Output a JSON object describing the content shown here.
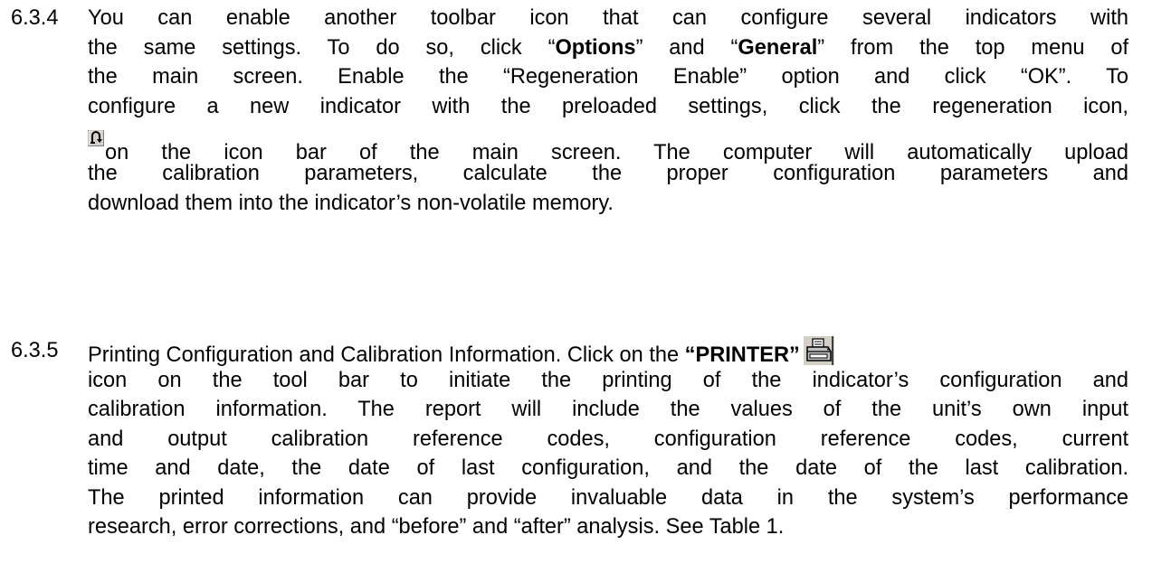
{
  "sec634": {
    "number": "6.3.4",
    "l1": "You can enable another toolbar icon that can configure several indicators with",
    "l2a": "the same settings.  To do so, click “",
    "l2b": "Options",
    "l2c": "” and “",
    "l2d": "General",
    "l2e": "” from the top menu of",
    "l3": "the main screen.  Enable the “Regeneration Enable” option and click “OK”.  To",
    "l4": "configure a new indicator with the preloaded settings, click the regeneration icon,",
    "l5": "on the icon bar of the main screen.  The computer will automatically upload",
    "l6": "the calibration parameters, calculate the proper configuration parameters and",
    "l7": "download them into the indicator’s non-volatile memory."
  },
  "sec635": {
    "number": "6.3.5",
    "l1a": "Printing Configuration and Calibration Information.  Click on the ",
    "l1b": "“PRINTER”",
    "l2": "icon on the tool bar to initiate the printing of the indicator’s configuration and",
    "l3": "calibration information.  The report will include the values of the unit’s own input",
    "l4": "and output calibration reference codes, configuration reference codes, current",
    "l5": "time and date, the date of last configuration, and the date of the last calibration.",
    "l6": "The printed information can provide invaluable data in the system’s performance",
    "l7": "research, error corrections, and “before” and “after” analysis.  See Table 1."
  },
  "icons": {
    "regen": "regeneration-icon",
    "printer": "printer-icon"
  }
}
